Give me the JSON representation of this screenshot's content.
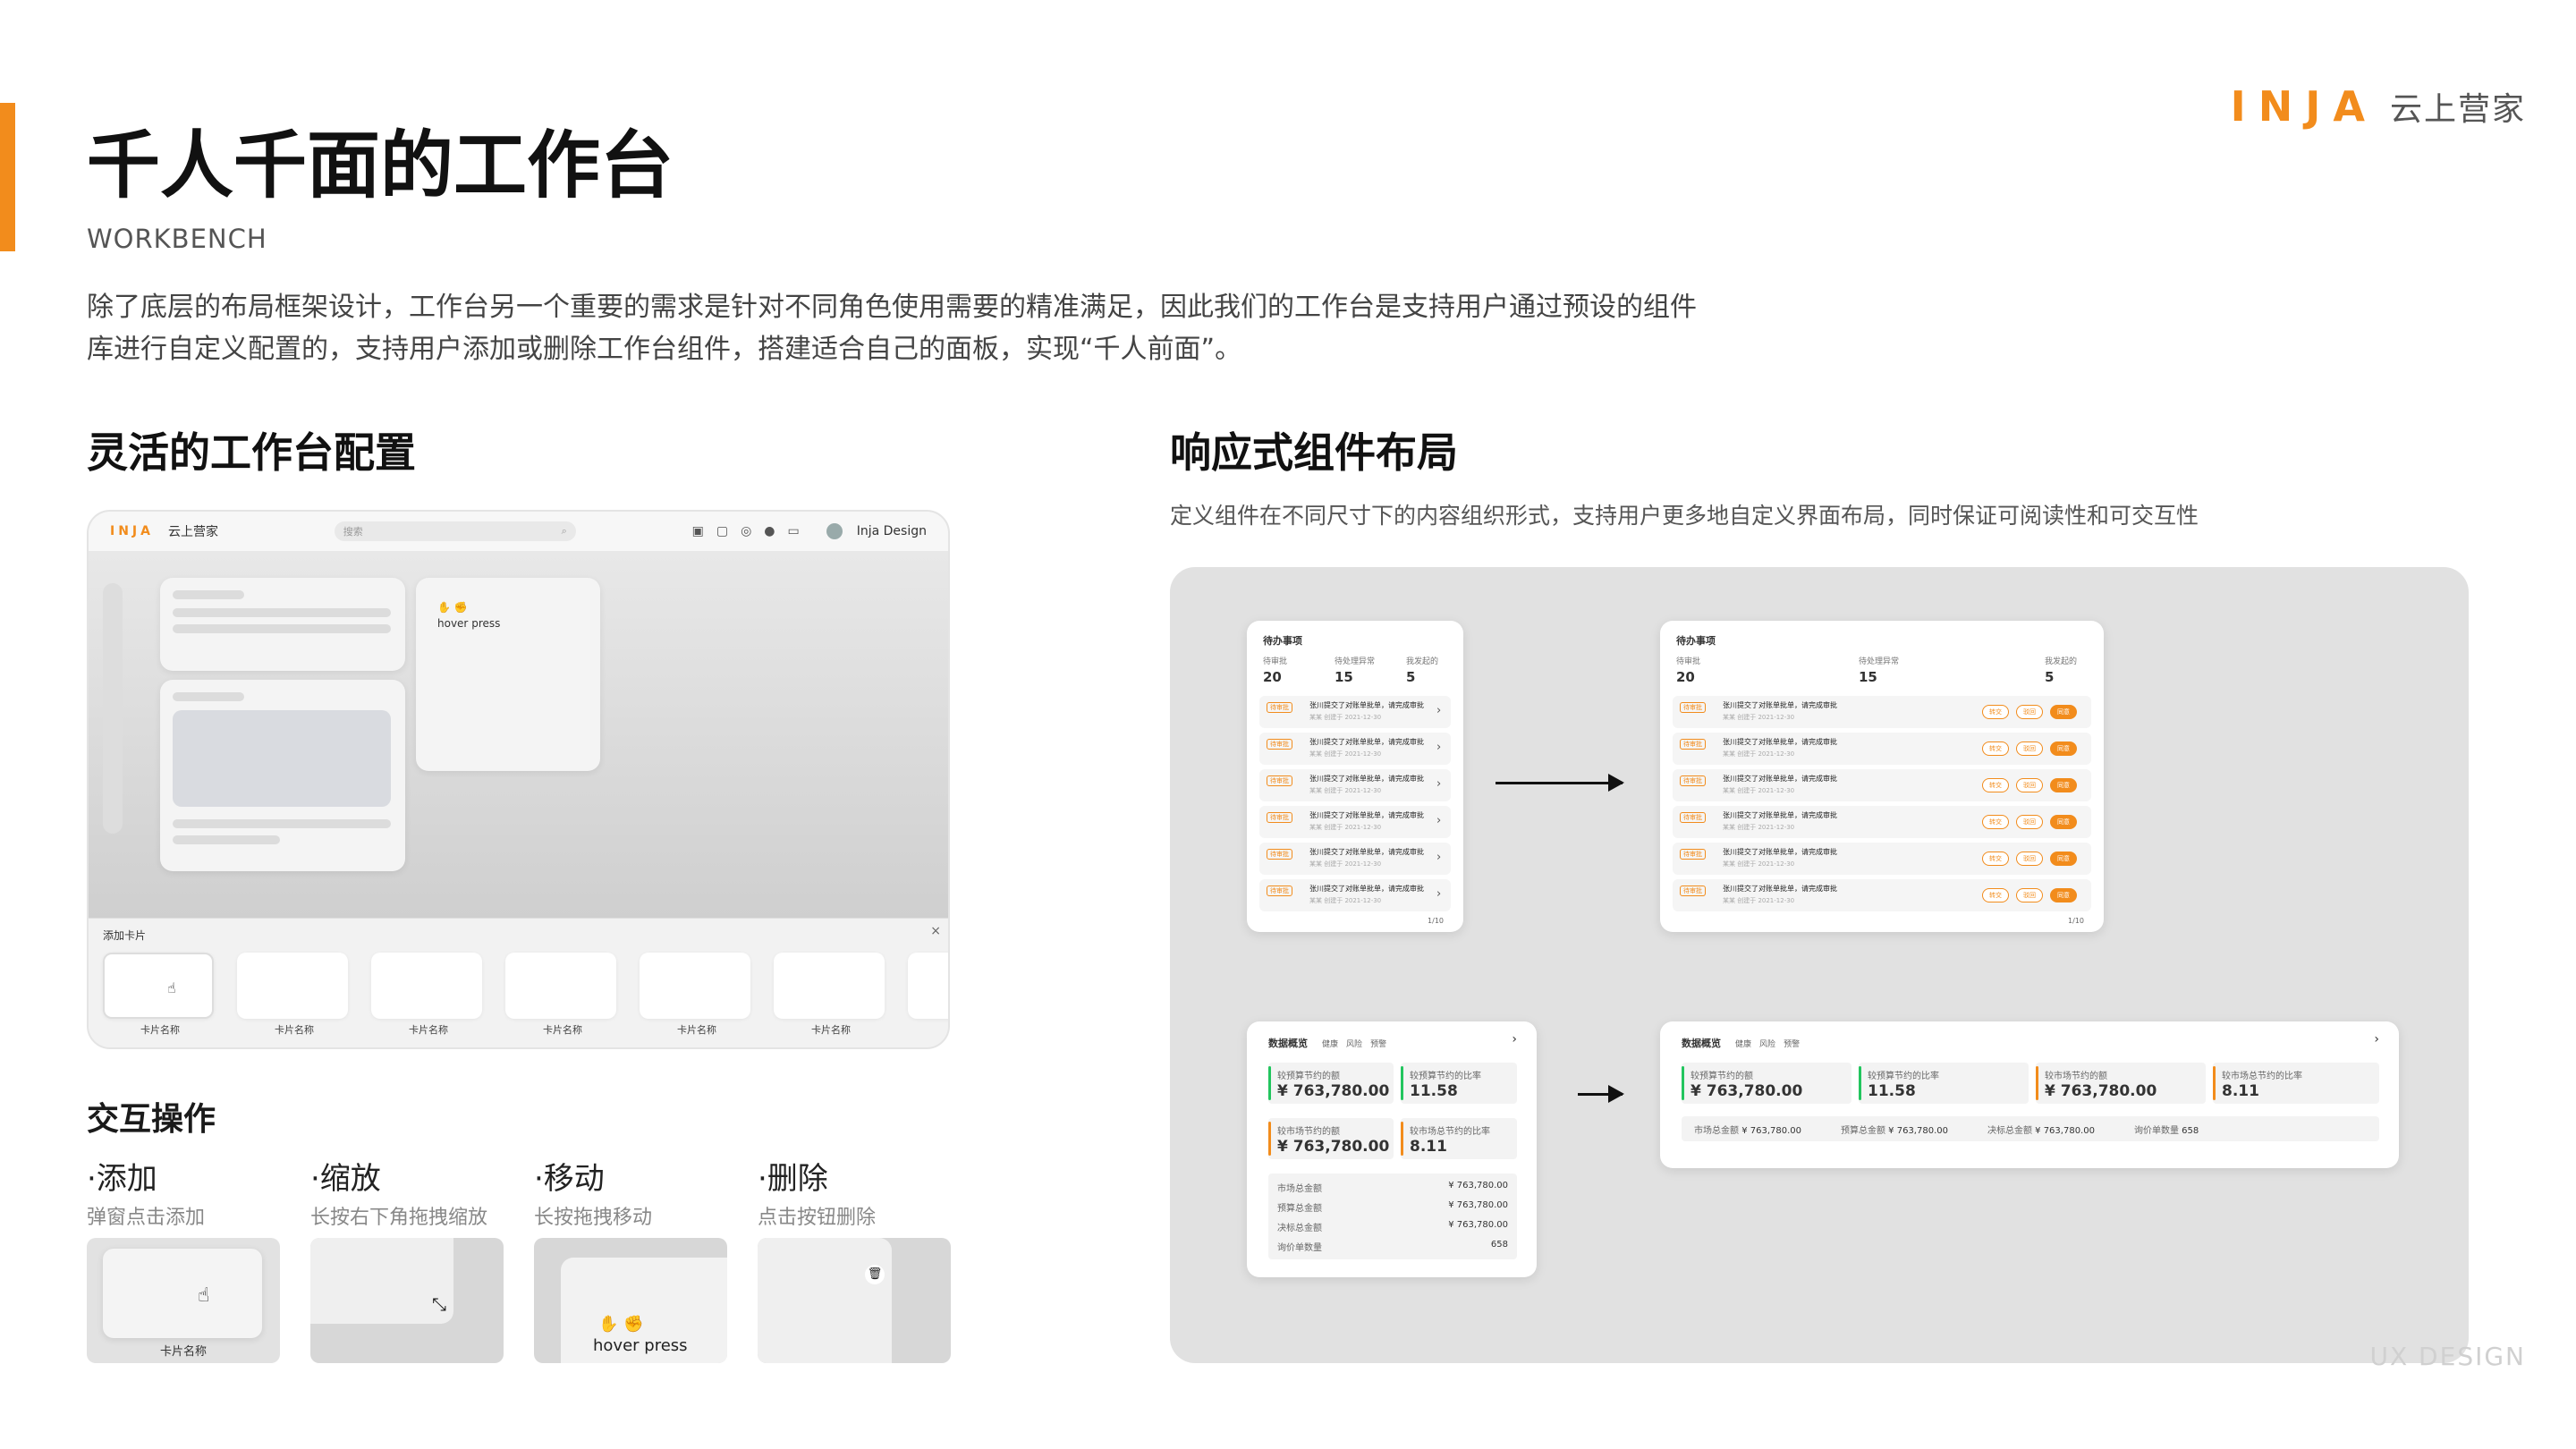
{
  "brand": {
    "mark": "INJA",
    "name": "云上营家"
  },
  "header": {
    "title": "千人千面的工作台",
    "subtitle": "WORKBENCH",
    "intro": "除了底层的布局框架设计，工作台另一个重要的需求是针对不同角色使用需要的精准满足，因此我们的工作台是支持用户通过预设的组件库进行自定义配置的，支持用户添加或删除工作台组件，搭建适合自己的面板，实现“千人前面”。"
  },
  "left": {
    "heading": "灵活的工作台配置",
    "mock": {
      "logo": "INJA",
      "logo_name": "云上营家",
      "search_placeholder": "搜索",
      "user": "Inja Design",
      "hover": "hover",
      "press": "press",
      "tray_title": "添加卡片",
      "card_name": "卡片名称"
    },
    "interaction": {
      "heading": "交互操作",
      "items": [
        {
          "title": "·添加",
          "desc": "弹窗点击添加",
          "label": "卡片名称"
        },
        {
          "title": "·缩放",
          "desc": "长按右下角拖拽缩放"
        },
        {
          "title": "·移动",
          "desc": "长按拖拽移动",
          "hover": "hover",
          "press": "press"
        },
        {
          "title": "·删除",
          "desc": "点击按钮删除"
        }
      ]
    }
  },
  "right": {
    "heading": "响应式组件布局",
    "desc": "定义组件在不同尺寸下的内容组织形式，支持用户更多地自定义界面布局，同时保证可阅读性和可交互性",
    "todo": {
      "title": "待办事项",
      "stats": [
        {
          "label": "待审批",
          "value": "20",
          "color": "#3b82f6"
        },
        {
          "label": "待处理异常",
          "value": "15",
          "color": "#ef4444"
        },
        {
          "label": "我发起的",
          "value": "5",
          "color": "#999999"
        }
      ],
      "row_tag": "待审批",
      "row_text": "张川提交了对账单批单，请完成审批",
      "row_sub": "某某 创建于 2021-12-30",
      "buttons": [
        "转交",
        "驳回",
        "同意"
      ],
      "pager": "1/10"
    },
    "overview": {
      "title": "数据概览",
      "legend": [
        "健康",
        "风险",
        "预警"
      ],
      "kpis": [
        {
          "label": "较预算节约的额",
          "value": "¥ 763,780.00",
          "color": "#22c55e"
        },
        {
          "label": "较预算节约的比率",
          "value": "11.58",
          "unit": "%",
          "color": "#22c55e"
        },
        {
          "label": "较市场节约的额",
          "value": "¥ 763,780.00",
          "color": "#f28c1c"
        },
        {
          "label": "较市场总节约的比率",
          "value": "8.11",
          "unit": "%",
          "color": "#f28c1c"
        }
      ],
      "totals": [
        {
          "label": "市场总金额",
          "value": "¥ 763,780.00"
        },
        {
          "label": "预算总金额",
          "value": "¥ 763,780.00"
        },
        {
          "label": "决标总金额",
          "value": "¥ 763,780.00"
        },
        {
          "label": "询价单数量",
          "value": "658"
        }
      ]
    }
  },
  "footer": {
    "watermark": "UX DESIGN"
  }
}
